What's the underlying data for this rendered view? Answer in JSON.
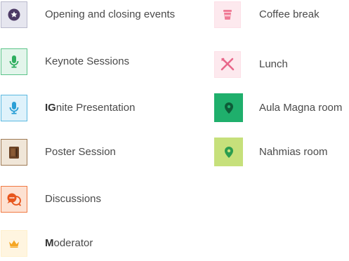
{
  "legend": {
    "left": [
      {
        "id": "opening",
        "label": "Opening and closing events",
        "icon": "star-icon",
        "bg": "#e6e6ef",
        "border": "#b9b9cc",
        "fg": "#4d3a66"
      },
      {
        "id": "keynote",
        "label": "Keynote Sessions",
        "icon": "microphone-icon",
        "bg": "#e3f5eb",
        "border": "#5cc489",
        "fg": "#2fae5f"
      },
      {
        "id": "ignite",
        "label_bold": "IG",
        "label_rest": "nite Presentation",
        "icon": "microphone-icon",
        "bg": "#dff2fb",
        "border": "#5ab8e0",
        "fg": "#2a9fd6"
      },
      {
        "id": "poster",
        "label": "Poster Session",
        "icon": "poster-icon",
        "bg": "#f0e6d8",
        "border": "#9e7a55",
        "fg": "#6b4326"
      },
      {
        "id": "discussions",
        "label": "Discussions",
        "icon": "discussion-icon",
        "bg": "#fde1d2",
        "border": "#f07a42",
        "fg": "#e8551d"
      },
      {
        "id": "moderator",
        "label_bold": "M",
        "label_rest": "oderator",
        "icon": "crown-icon",
        "bg": "#fff5e0",
        "border": "#fff0cc",
        "fg": "#f5a623"
      }
    ],
    "right": [
      {
        "id": "coffee",
        "label": "Coffee break",
        "icon": "coffee-cup-icon",
        "bg": "#fde9ee",
        "border": "#fde0e7",
        "fg": "#ef7b96"
      },
      {
        "id": "lunch",
        "label": "Lunch",
        "icon": "utensils-icon",
        "bg": "#fde9ee",
        "border": "#fde0e7",
        "fg": "#e8678a"
      },
      {
        "id": "aula",
        "label": "Aula Magna room",
        "icon": "location-pin-icon",
        "bg": "#1faf6c",
        "border": "#1faf6c",
        "fg": "#0d5c38"
      },
      {
        "id": "nahmias",
        "label": "Nahmias room",
        "icon": "location-pin-icon",
        "bg": "#c6e07b",
        "border": "#c6e07b",
        "fg": "#2a9d4f"
      }
    ]
  }
}
